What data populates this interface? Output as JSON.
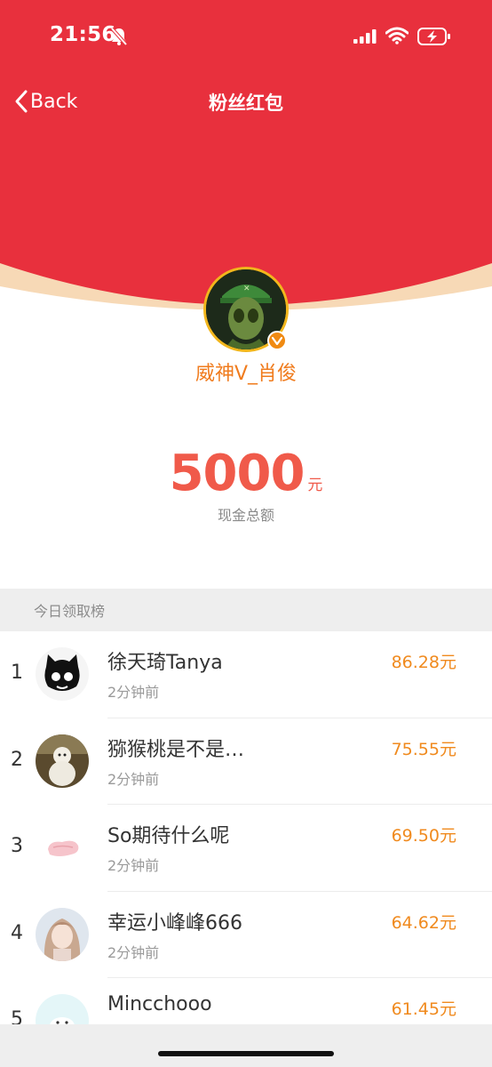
{
  "status_bar": {
    "time": "21:56",
    "icons": [
      "bell-muted-icon",
      "cellular-signal-icon",
      "wifi-icon",
      "battery-charging-icon"
    ]
  },
  "nav": {
    "back_label": "Back",
    "title": "粉丝红包"
  },
  "profile": {
    "username": "威神V_肖俊",
    "verified_icon": "verified-icon"
  },
  "total": {
    "amount": "5000",
    "unit": "元",
    "label": "现金总额"
  },
  "leaderboard": {
    "title": "今日领取榜",
    "items": [
      {
        "rank": "1",
        "name": "徐天琦Tanya",
        "time": "2分钟前",
        "amount": "86.28元"
      },
      {
        "rank": "2",
        "name": "猕猴桃是不是…",
        "time": "2分钟前",
        "amount": "75.55元"
      },
      {
        "rank": "3",
        "name": "So期待什么呢",
        "time": "2分钟前",
        "amount": "69.50元"
      },
      {
        "rank": "4",
        "name": "幸运小峰峰666",
        "time": "2分钟前",
        "amount": "64.62元"
      },
      {
        "rank": "5",
        "name": "Mincchooo",
        "time": "",
        "amount": "61.45元"
      }
    ]
  },
  "colors": {
    "header_red": "#e8303d",
    "amount_red": "#f05a4a",
    "accent_orange": "#f08a1e"
  }
}
